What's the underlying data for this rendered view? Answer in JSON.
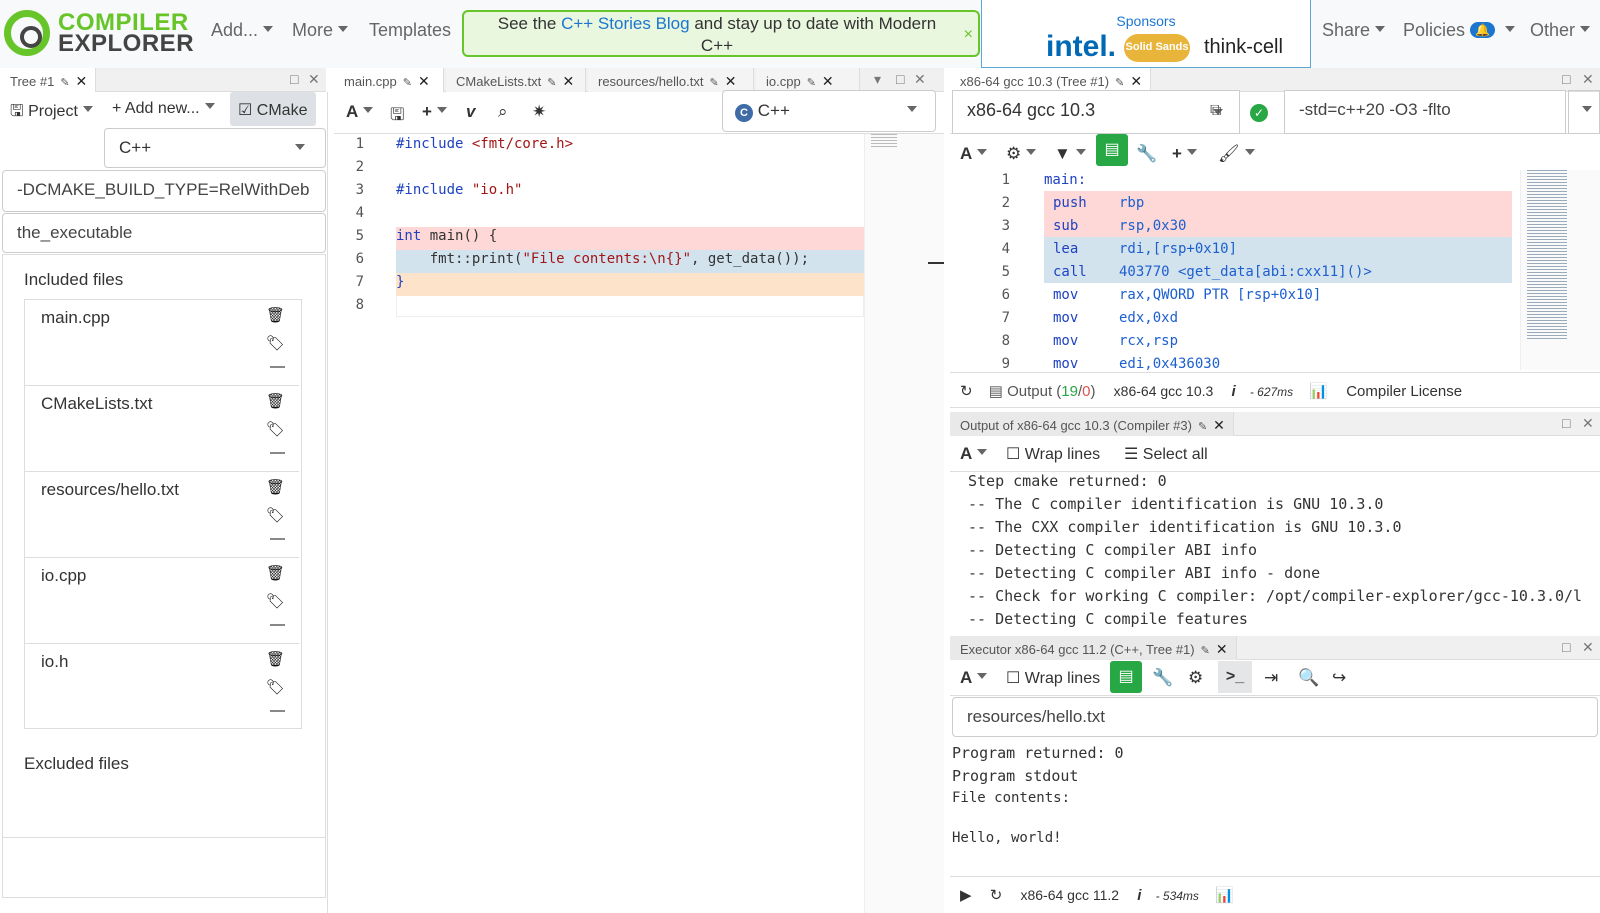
{
  "nav": {
    "logo_line1": "COMPILER",
    "logo_line2": "EXPLORER",
    "add": "Add...",
    "more": "More",
    "templates": "Templates",
    "banner_pre": "See the ",
    "banner_link": "C++ Stories Blog",
    "banner_post": " and stay up to date with Modern C++",
    "banner_close": "×",
    "sponsors_label": "Sponsors",
    "sponsor1": "intel.",
    "sponsor2": "Solid Sands",
    "sponsor3": "think-cell",
    "share": "Share",
    "policies": "Policies",
    "policies_badge": "🔔",
    "other": "Other"
  },
  "tree": {
    "tab": "Tree #1",
    "project": "Project",
    "add_new": "Add new...",
    "cmake": "CMake",
    "language": "C++",
    "cmake_args": "-DCMAKE_BUILD_TYPE=RelWithDeb",
    "executable": "the_executable",
    "included_label": "Included files",
    "files": [
      "main.cpp",
      "CMakeLists.txt",
      "resources/hello.txt",
      "io.cpp",
      "io.h"
    ],
    "excluded_label": "Excluded files"
  },
  "editor": {
    "tabs": [
      "main.cpp",
      "CMakeLists.txt",
      "resources/hello.txt",
      "io.cpp"
    ],
    "language": "C++",
    "lines": [
      "1",
      "2",
      "3",
      "4",
      "5",
      "6",
      "7",
      "8"
    ],
    "code": {
      "l1a": "#include ",
      "l1b": "<fmt/core.h>",
      "l3a": "#include ",
      "l3b": "\"io.h\"",
      "l5a": "int",
      "l5b": " main() {",
      "l6a": "    fmt::print(",
      "l6b": "\"File contents:\\n{}\"",
      "l6c": ", get_data());",
      "l7": "}"
    }
  },
  "compiler": {
    "tab": "x86-64 gcc 10.3 (Tree #1)",
    "name": "x86-64 gcc 10.3",
    "options": "-std=c++20 -O3 -flto",
    "lines": [
      "1",
      "2",
      "3",
      "4",
      "5",
      "6",
      "7",
      "8",
      "9"
    ],
    "asm": [
      {
        "op": "main:",
        "args": ""
      },
      {
        "op": "push",
        "args": "rbp"
      },
      {
        "op": "sub",
        "args": "rsp,0x30"
      },
      {
        "op": "lea",
        "args": "rdi,[rsp+0x10]"
      },
      {
        "op": "call",
        "args": "403770 <get_data[abi:cxx11]()>"
      },
      {
        "op": "mov",
        "args": "rax,QWORD PTR [rsp+0x10]"
      },
      {
        "op": "mov",
        "args": "edx,0xd"
      },
      {
        "op": "mov",
        "args": "rcx,rsp"
      },
      {
        "op": "mov",
        "args": "edi,0x436030"
      }
    ],
    "output_label": "Output (",
    "output_ok": "19",
    "output_sep": "/",
    "output_err": "0",
    "output_close": ")",
    "status_name": "x86-64 gcc 10.3",
    "info": "i",
    "time": "- 627ms",
    "license": "Compiler License"
  },
  "output_pane": {
    "tab": "Output of x86-64 gcc 10.3 (Compiler #3)",
    "wrap": "Wrap lines",
    "select_all": "Select all",
    "lines": [
      "Step cmake returned: 0",
      "-- The C compiler identification is GNU 10.3.0",
      "-- The CXX compiler identification is GNU 10.3.0",
      "-- Detecting C compiler ABI info",
      "-- Detecting C compiler ABI info - done",
      "-- Check for working C compiler: /opt/compiler-explorer/gcc-10.3.0/l",
      "-- Detecting C compile features"
    ]
  },
  "executor": {
    "tab": "Executor x86-64 gcc 11.2 (C++, Tree #1)",
    "wrap": "Wrap lines",
    "stdin": "resources/hello.txt",
    "returned": "Program returned: 0",
    "stdout_label": "Program stdout",
    "stdout1": "File contents:",
    "stdout2": "Hello, world!",
    "status_name": "x86-64 gcc 11.2",
    "info": "i",
    "time": "- 534ms"
  }
}
